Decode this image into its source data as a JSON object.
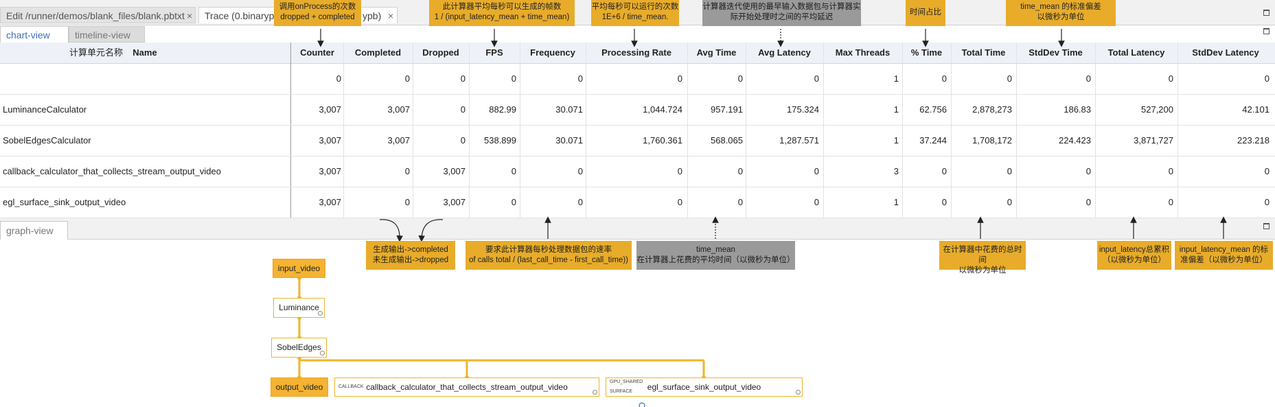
{
  "file_tabs": [
    {
      "label": "Edit /runner/demos/blank_files/blank.pbtxt",
      "close": "×"
    },
    {
      "label": "Trace (0.binarypb",
      "suffix": "ypb)",
      "close": "×"
    }
  ],
  "top_views": {
    "chart": "chart-view",
    "timeline": "timeline-view"
  },
  "graph_view_label": "graph-view",
  "table": {
    "name_header_cn": "计算单元名称",
    "columns": [
      "Name",
      "Counter",
      "Completed",
      "Dropped",
      "FPS",
      "Frequency",
      "Processing Rate",
      "Avg Time",
      "Avg Latency",
      "Max Threads",
      "% Time",
      "Total Time",
      "StdDev Time",
      "Total Latency",
      "StdDev Latency"
    ],
    "rows": [
      {
        "name": "",
        "values": [
          "0",
          "0",
          "0",
          "0",
          "0",
          "0",
          "0",
          "0",
          "1",
          "0",
          "0",
          "0",
          "0",
          "0"
        ]
      },
      {
        "name": "LuminanceCalculator",
        "values": [
          "3,007",
          "3,007",
          "0",
          "882.99",
          "30.071",
          "1,044.724",
          "957.191",
          "175.324",
          "1",
          "62.756",
          "2,878,273",
          "186.83",
          "527,200",
          "42.101"
        ]
      },
      {
        "name": "SobelEdgesCalculator",
        "values": [
          "3,007",
          "3,007",
          "0",
          "538.899",
          "30.071",
          "1,760.361",
          "568.065",
          "1,287.571",
          "1",
          "37.244",
          "1,708,172",
          "224.423",
          "3,871,727",
          "223.218"
        ]
      },
      {
        "name": "callback_calculator_that_collects_stream_output_video",
        "values": [
          "3,007",
          "0",
          "3,007",
          "0",
          "0",
          "0",
          "0",
          "0",
          "3",
          "0",
          "0",
          "0",
          "0",
          "0"
        ]
      },
      {
        "name": "egl_surface_sink_output_video",
        "values": [
          "3,007",
          "0",
          "3,007",
          "0",
          "0",
          "0",
          "0",
          "0",
          "1",
          "0",
          "0",
          "0",
          "0",
          "0"
        ]
      }
    ]
  },
  "annotations_top": [
    {
      "l1": "调用onProcess的次数",
      "l2": "dropped + completed"
    },
    {
      "l1": "此计算器平均每秒可以生成的帧数",
      "l2": "1 / (input_latency_mean + time_mean)"
    },
    {
      "l1": "平均每秒可以运行的次数",
      "l2": "1E+6 / time_mean."
    },
    {
      "l1": "计算器迭代使用的最早输入数据包与计算器实",
      "l2": "际开始处理时之间的平均延迟"
    },
    {
      "l1": "时间占比",
      "l2": ""
    },
    {
      "l1": "time_mean 的标准偏差",
      "l2": "以微秒为单位"
    }
  ],
  "annotations_bottom": [
    {
      "l1": "生成输出->completed",
      "l2": "未生成输出->dropped"
    },
    {
      "l1": "要求此计算器每秒处理数据包的速率",
      "l2": "of calls total / (last_call_time - first_call_time))"
    },
    {
      "l1": "time_mean",
      "l2": "在计算器上花费的平均时间（以微秒为单位）"
    },
    {
      "l1": "在计算器中花费的总时间",
      "l2": "以微秒为单位"
    },
    {
      "l1": "input_latency总累积",
      "l2": "（以微秒为单位）"
    },
    {
      "l1": "input_latency_mean 的标",
      "l2": "准偏差（以微秒为单位）"
    }
  ],
  "graph": {
    "nodes": {
      "input_video": "input_video",
      "luminance": "Luminance",
      "sobel": "SobelEdges",
      "output_video": "output_video",
      "callback": "callback_calculator_that_collects_stream_output_video",
      "egl": "egl_surface_sink_output_video"
    },
    "port_labels": {
      "callback": "CALLBACK",
      "gpu_shared": "GPU_SHARED",
      "surface": "SURFACE"
    }
  },
  "colors": {
    "accent": "#f0b429",
    "note_yellow": "#e8ac2a",
    "note_gray": "#9a9a9a",
    "tab_blue": "#3f6fb0"
  }
}
